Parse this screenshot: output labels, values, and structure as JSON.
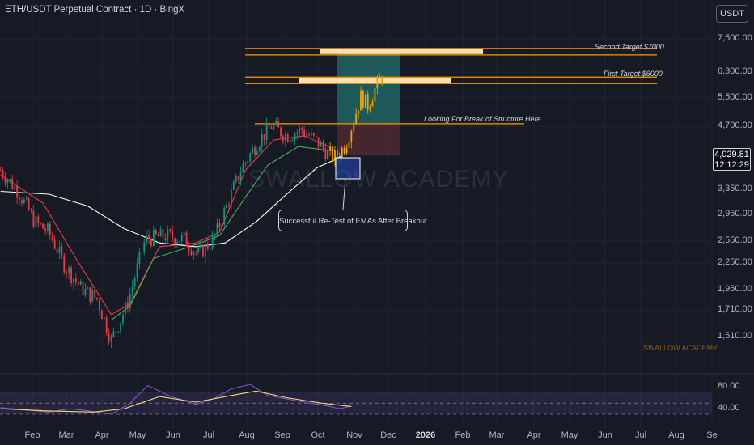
{
  "header": {
    "title": "ETH/USDT Perpetual Contract · 1D · BingX",
    "currency_label": "USDT"
  },
  "price_tag": {
    "price": "4,029.81",
    "countdown": "12:12:29"
  },
  "watermark": "SWALLOW ACADEMY",
  "brand_small": "SWALLOW ACADEMY",
  "annotations": {
    "second_target": "Second Target $7000",
    "first_target": "First Target $6000",
    "break_of_structure": "Looking For Break of Structure Here",
    "retest_callout": "Successful Re-Test of EMAs After Breakout"
  },
  "colors": {
    "background": "#161a25",
    "target_line": "#ff9800",
    "target_band": "#ffe0b2",
    "up_candle": "#089981",
    "down_candle": "#f23645",
    "highlight_candle": "#f0a500",
    "ema_fast": "#f23645",
    "ema_mid": "#4caf50",
    "ema_slow": "#ffffff",
    "rsi_line": "#7e57c2",
    "rsi_ma": "#f5d76e",
    "long_profit": "#26a69a",
    "long_risk": "#ef5350",
    "retest_box": "#1e3a8a"
  },
  "chart_data": [
    {
      "type": "candlestick",
      "title": "ETH/USDT Perpetual Contract · 1D · BingX",
      "x_axis_labels": [
        "Feb",
        "Mar",
        "Apr",
        "May",
        "Jun",
        "Jul",
        "Aug",
        "Sep",
        "Oct",
        "Nov",
        "Dec",
        "2026",
        "Feb",
        "Mar",
        "Apr",
        "May",
        "Jun",
        "Jul",
        "Aug",
        "Se"
      ],
      "y_axis_labels": [
        "7,500.00",
        "6,300.00",
        "5,500.00",
        "4,700.00",
        "3,350.00",
        "2,950.00",
        "2,550.00",
        "2,250.00",
        "1,950.00",
        "1,710.00",
        "1,510.00"
      ],
      "y_scale": "log",
      "last_price": 4029.81,
      "series": [
        {
          "kind": "close_path",
          "x": [
            "2025-01-05",
            "2025-01-20",
            "2025-02-03",
            "2025-02-15",
            "2025-03-01",
            "2025-03-15",
            "2025-03-28",
            "2025-04-09",
            "2025-04-22",
            "2025-05-08",
            "2025-05-25",
            "2025-06-10",
            "2025-06-22",
            "2025-07-05",
            "2025-07-15",
            "2025-07-28",
            "2025-08-10",
            "2025-08-23",
            "2025-09-05",
            "2025-09-18",
            "2025-10-01",
            "2025-10-10",
            "2025-10-17",
            "2025-10-25",
            "2025-11-01",
            "2025-11-07",
            "2025-11-13",
            "2025-11-20",
            "2025-11-26"
          ],
          "y": [
            3700,
            3300,
            2800,
            2650,
            2200,
            1950,
            1850,
            1480,
            1780,
            2550,
            2600,
            2550,
            2350,
            2550,
            3000,
            3700,
            4250,
            4700,
            4450,
            4600,
            4300,
            4050,
            3950,
            4250,
            4850,
            5500,
            5250,
            5800,
            6200
          ]
        },
        {
          "name": "EMA fast",
          "x": [
            "2025-01-05",
            "2025-02-10",
            "2025-03-10",
            "2025-04-09",
            "2025-04-25",
            "2025-05-20",
            "2025-06-20",
            "2025-07-10",
            "2025-08-01",
            "2025-08-25",
            "2025-09-20",
            "2025-10-15"
          ],
          "y": [
            3600,
            3100,
            2300,
            1700,
            1800,
            2450,
            2500,
            2650,
            3700,
            4350,
            4450,
            4150
          ]
        },
        {
          "name": "EMA mid",
          "x": [
            "2025-04-09",
            "2025-04-25",
            "2025-05-15",
            "2025-06-15",
            "2025-07-10",
            "2025-08-01",
            "2025-08-20",
            "2025-09-15",
            "2025-10-15"
          ],
          "y": [
            1650,
            1780,
            2300,
            2450,
            2600,
            3200,
            3800,
            4200,
            4100
          ]
        },
        {
          "name": "EMA slow",
          "x": [
            "2025-01-05",
            "2025-02-15",
            "2025-03-20",
            "2025-04-20",
            "2025-05-20",
            "2025-06-20",
            "2025-07-15",
            "2025-08-10",
            "2025-09-05",
            "2025-10-01",
            "2025-10-15",
            "2025-10-22"
          ],
          "y": [
            3300,
            3250,
            3050,
            2700,
            2500,
            2450,
            2500,
            2800,
            3250,
            3750,
            3900,
            4000
          ]
        }
      ],
      "levels": [
        {
          "label": "Second Target $7000",
          "value": 7000
        },
        {
          "label": "First Target $6000",
          "value": 6000
        },
        {
          "label": "Looking For Break of Structure Here",
          "value": 4750
        }
      ],
      "position": {
        "entry": 4750,
        "target": 7000,
        "stop": 4000
      }
    },
    {
      "type": "line",
      "name": "RSI",
      "y_axis_labels": [
        "80.00",
        "40.00"
      ],
      "ylim": [
        30,
        90
      ],
      "band": [
        30,
        70
      ],
      "series": [
        {
          "name": "RSI",
          "x": [
            "2025-01-05",
            "2025-01-25",
            "2025-02-15",
            "2025-03-05",
            "2025-03-25",
            "2025-04-09",
            "2025-04-25",
            "2025-05-10",
            "2025-05-30",
            "2025-06-20",
            "2025-07-05",
            "2025-07-20",
            "2025-08-05",
            "2025-08-20",
            "2025-09-05",
            "2025-09-20",
            "2025-10-05",
            "2025-10-20",
            "2025-10-30"
          ],
          "y": [
            42,
            38,
            34,
            40,
            35,
            30,
            50,
            82,
            62,
            48,
            58,
            76,
            84,
            64,
            58,
            52,
            47,
            40,
            45
          ]
        },
        {
          "name": "RSI MA",
          "x": [
            "2025-01-05",
            "2025-02-15",
            "2025-03-25",
            "2025-04-20",
            "2025-05-20",
            "2025-06-20",
            "2025-07-20",
            "2025-08-10",
            "2025-09-05",
            "2025-10-05",
            "2025-10-30"
          ],
          "y": [
            40,
            36,
            34,
            40,
            62,
            52,
            64,
            72,
            60,
            50,
            44
          ]
        }
      ]
    }
  ]
}
